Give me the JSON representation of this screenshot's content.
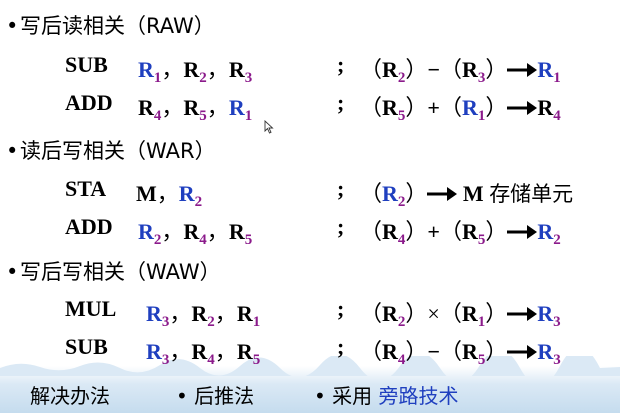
{
  "sections": [
    {
      "title": "写后读相关（RAW）"
    },
    {
      "title": "读后写相关（WAR）"
    },
    {
      "title": "写后写相关（WAW）"
    }
  ],
  "instructions": [
    {
      "op": "SUB",
      "a1": "R",
      "s1": "1",
      "a2": "R",
      "s2": "2",
      "a3": "R",
      "s3": "3",
      "e1": "R",
      "es1": "2",
      "eop": "−",
      "e2": "R",
      "es2": "3",
      "r": "R",
      "rs": "1"
    },
    {
      "op": "ADD",
      "a1": "R",
      "s1": "4",
      "a2": "R",
      "s2": "5",
      "a3": "R",
      "s3": "1",
      "e1": "R",
      "es1": "5",
      "eop": "+",
      "e2": "R",
      "es2": "1",
      "r": "R",
      "rs": "4"
    },
    {
      "op": "STA",
      "a1": "M",
      "a2": "R",
      "s2": "2",
      "e1": "R",
      "es1": "2",
      "dest": "M",
      "dest_cn": "存储单元"
    },
    {
      "op": "ADD",
      "a1": "R",
      "s1": "2",
      "a2": "R",
      "s2": "4",
      "a3": "R",
      "s3": "5",
      "e1": "R",
      "es1": "4",
      "eop": "+",
      "e2": "R",
      "es2": "5",
      "r": "R",
      "rs": "2"
    },
    {
      "op": "MUL",
      "a1": "R",
      "s1": "3",
      "a2": "R",
      "s2": "2",
      "a3": "R",
      "s3": "1",
      "e1": "R",
      "es1": "2",
      "eop": "×",
      "e2": "R",
      "es2": "1",
      "r": "R",
      "rs": "3"
    },
    {
      "op": "SUB",
      "a1": "R",
      "s1": "3",
      "a2": "R",
      "s2": "4",
      "a3": "R",
      "s3": "5",
      "e1": "R",
      "es1": "4",
      "eop": "−",
      "e2": "R",
      "es2": "5",
      "r": "R",
      "rs": "3"
    }
  ],
  "punct": {
    "comma": "，",
    "semicolon": ";",
    "lparen": "（",
    "rparen": "）",
    "bullet": "•"
  },
  "bottom": {
    "label": "解决办法",
    "m1": "后推法",
    "m2_prefix": "采用",
    "m2_highlight": "旁路技术"
  },
  "colors": {
    "blue": "#1f3fbf",
    "magenta": "#8b1a8b"
  }
}
